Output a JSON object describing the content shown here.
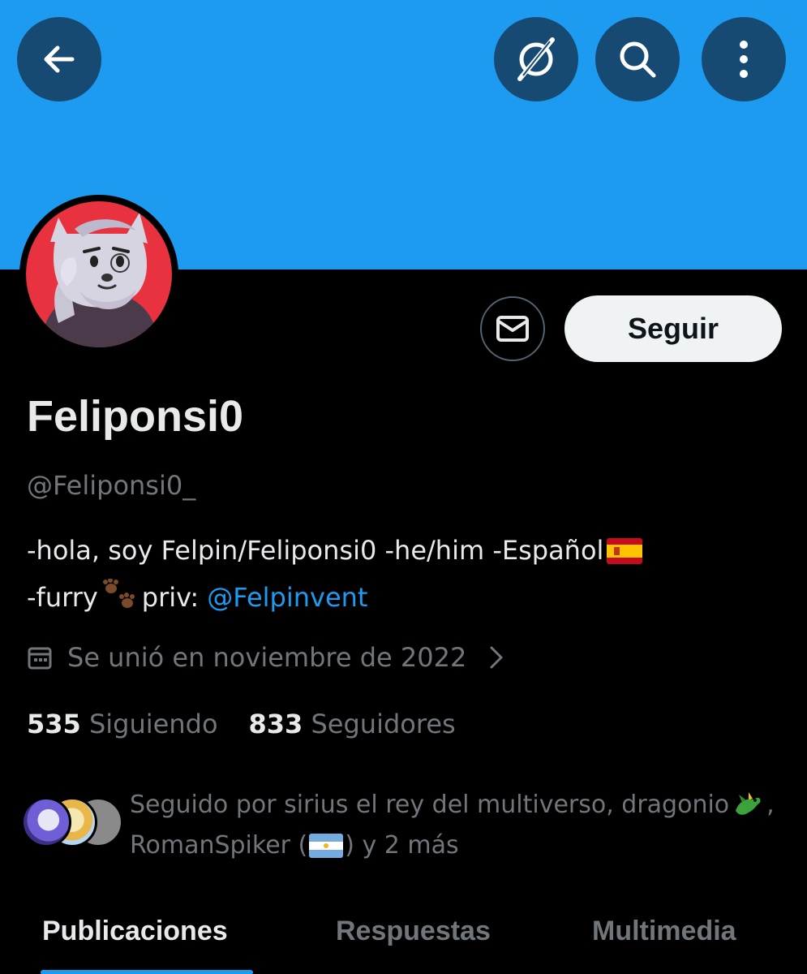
{
  "header": {
    "back_icon": "arrow-left-icon",
    "grok_icon": "grok-slash-circle-icon",
    "search_icon": "search-icon",
    "more_icon": "more-vertical-icon",
    "banner_color": "#1d9bf0",
    "button_color": "#174a72"
  },
  "profile": {
    "avatar_icon": "furry-avatar",
    "display_name": "Feliponsi0",
    "handle": "@Feliponsi0_",
    "bio_line1_a": "-hola, soy Felpin/Feliponsi0  -he/him -Español",
    "bio_line1_flag": "spain-flag-icon",
    "bio_line2_a": "-furry",
    "bio_line2_paw": "paw-prints-icon",
    "bio_line2_b": "priv:",
    "bio_mention": "@Felpinvent",
    "joined": "Se unió en noviembre de 2022",
    "following_count": "535",
    "following_label": "Siguiendo",
    "followers_count": "833",
    "followers_label": "Seguidores"
  },
  "actions": {
    "message_icon": "envelope-icon",
    "follow_label": "Seguir"
  },
  "followed_by": {
    "line1": "Seguido por sirius el rey del multiverso, dragonio",
    "line1_emoji": "dragon-emoji",
    "line1_end": ",",
    "line2_a": "RomanSpiker (",
    "line2_flag": "argentina-flag-icon",
    "line2_b": ") y 2 más"
  },
  "tabs": [
    {
      "label": "Publicaciones",
      "active": true
    },
    {
      "label": "Respuestas",
      "active": false
    },
    {
      "label": "Multimedia",
      "active": false
    }
  ],
  "colors": {
    "accent": "#1d9bf0",
    "text_primary": "#e7e9ea",
    "text_secondary": "#71767b"
  }
}
